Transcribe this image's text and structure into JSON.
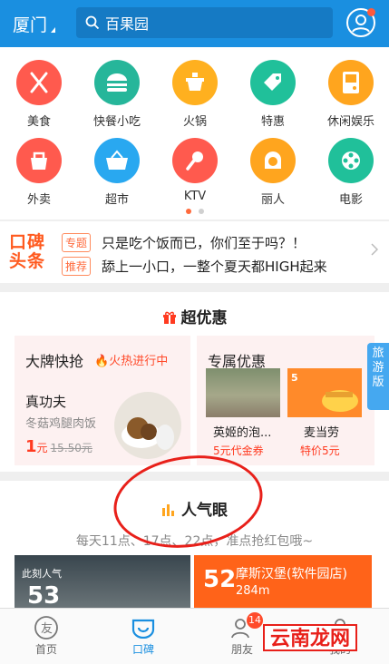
{
  "header": {
    "city": "厦门",
    "search_text": "百果园"
  },
  "categories": [
    {
      "label": "美食",
      "color": "#ff5a4e",
      "icon": "fork-knife-icon"
    },
    {
      "label": "快餐小吃",
      "color": "#26b69a",
      "icon": "burger-icon"
    },
    {
      "label": "火锅",
      "color": "#ffb01f",
      "icon": "hotpot-icon"
    },
    {
      "label": "特惠",
      "color": "#20c09a",
      "icon": "tag-icon"
    },
    {
      "label": "休闲娱乐",
      "color": "#ffa51e",
      "icon": "gameboy-icon"
    },
    {
      "label": "外卖",
      "color": "#ff5a4e",
      "icon": "takeout-bag-icon"
    },
    {
      "label": "超市",
      "color": "#29a8f0",
      "icon": "basket-icon"
    },
    {
      "label": "KTV",
      "color": "#ff5a4e",
      "icon": "microphone-icon"
    },
    {
      "label": "丽人",
      "color": "#ffa51e",
      "icon": "woman-icon"
    },
    {
      "label": "电影",
      "color": "#20c09a",
      "icon": "film-reel-icon"
    }
  ],
  "news": {
    "logo_line1": "口碑",
    "logo_line2": "头条",
    "items": [
      {
        "tag": "专题",
        "text": "只是吃个饭而已，你们至于吗？！"
      },
      {
        "tag": "推荐",
        "text": "舔上一小口，一整个夏天都HIGH起来"
      }
    ]
  },
  "deals": {
    "title": "超优惠",
    "left": {
      "title": "大牌快抢",
      "hot": "火热进行中",
      "name": "真功夫",
      "desc": "冬菇鸡腿肉饭",
      "price": "1",
      "price_unit": "元",
      "orig": "15.50元"
    },
    "right": {
      "title": "专属优惠",
      "items": [
        {
          "name": "英姬的泡...",
          "offer": "5元代金券"
        },
        {
          "name": "麦当劳",
          "offer": "特价5元"
        }
      ]
    },
    "travel_tab": "旅游版"
  },
  "popular": {
    "title": "人气眼",
    "subtitle": "每天11点、17点、22点，准点抢红包哦~",
    "img_label": "此刻人气",
    "img_num": "53",
    "card_num": "52",
    "card_name": "摩斯汉堡(软件园店)",
    "card_dist": "284m"
  },
  "tabbar": {
    "items": [
      {
        "label": "首页"
      },
      {
        "label": "口碑"
      },
      {
        "label": "朋友",
        "badge": "14"
      },
      {
        "label": "我的"
      }
    ]
  },
  "watermark": "云南龙网",
  "colors": {
    "primary": "#1a8fe0",
    "accent": "#ff6319",
    "hot": "#ff4a2a"
  }
}
